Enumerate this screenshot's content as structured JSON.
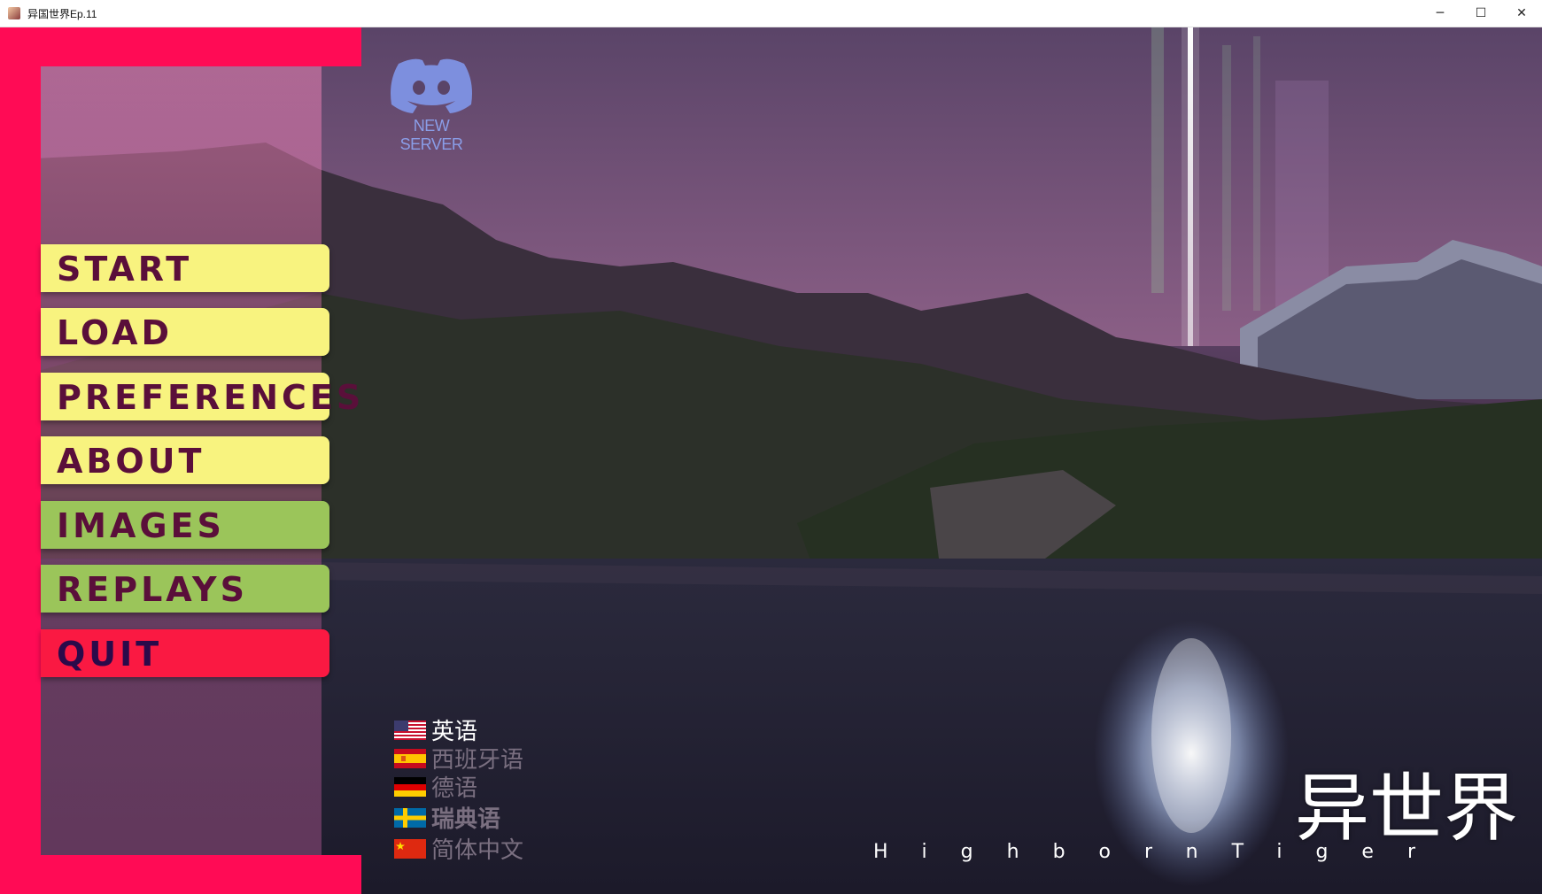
{
  "window": {
    "title": "异国世界Ep.11",
    "minimize_glyph": "─",
    "maximize_glyph": "☐",
    "close_glyph": "✕"
  },
  "menu": {
    "items": [
      {
        "label": "START",
        "color": "yellow"
      },
      {
        "label": "LOAD",
        "color": "yellow"
      },
      {
        "label": "PREFERENCES",
        "color": "yellow"
      },
      {
        "label": "ABOUT",
        "color": "yellow"
      },
      {
        "label": "IMAGES",
        "color": "green"
      },
      {
        "label": "REPLAYS",
        "color": "green"
      },
      {
        "label": "QUIT",
        "color": "red"
      }
    ]
  },
  "discord": {
    "icon": "discord-icon",
    "label": "NEW SERVER"
  },
  "languages": [
    {
      "label": "英语",
      "flag": "us-flag-icon",
      "active": true
    },
    {
      "label": "西班牙语",
      "flag": "spain-flag-icon",
      "active": false
    },
    {
      "label": "德语",
      "flag": "germany-flag-icon",
      "active": false
    },
    {
      "label": "瑞典语",
      "flag": "sweden-flag-icon",
      "active": false
    },
    {
      "label": "简体中文",
      "flag": "china-flag-icon",
      "active": false
    }
  ],
  "logo": {
    "title": "异世界",
    "subtitle": "HighbornTiger"
  },
  "colors": {
    "panel_accent": "#ff0b55",
    "button_yellow": "#f8f37f",
    "button_green": "#9bc55a",
    "button_red": "#fa1942"
  }
}
